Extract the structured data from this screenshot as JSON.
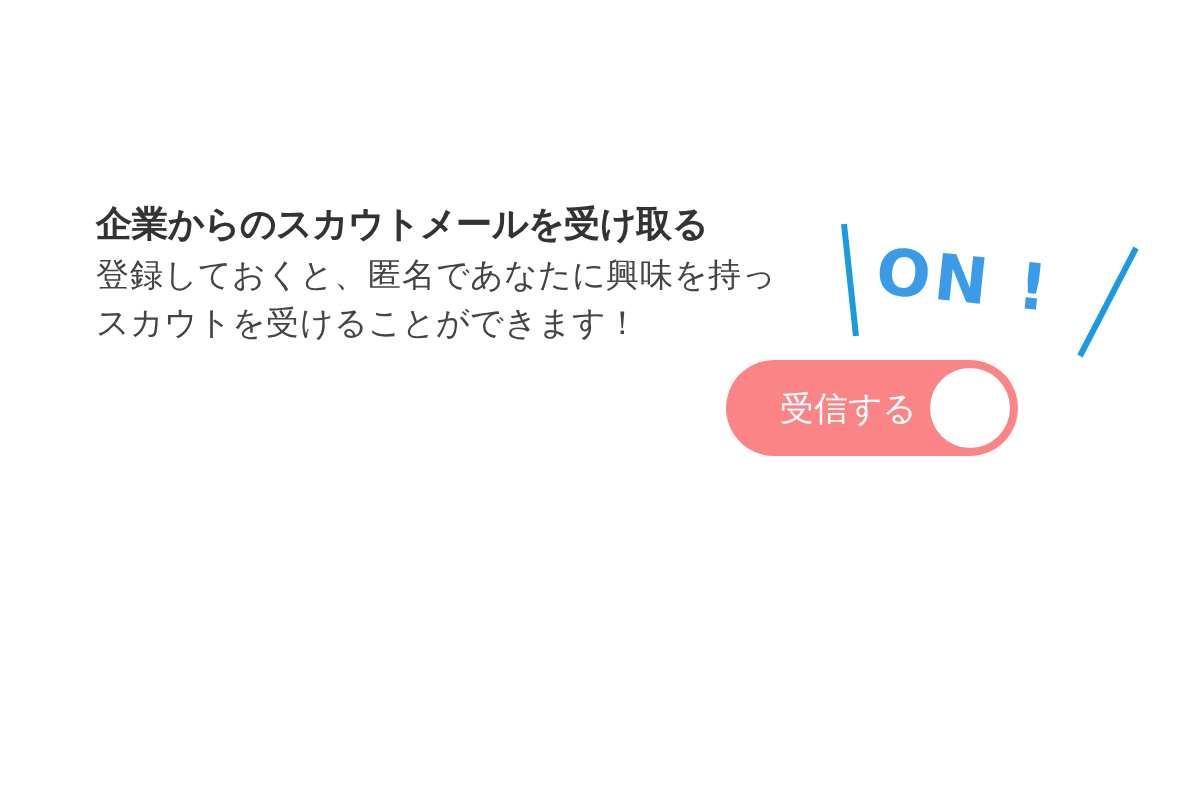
{
  "heading": "企業からのスカウトメールを受け取る",
  "description": "登録しておくと、匿名であなたに興味を持っスカウトを受けることができます！",
  "toggle": {
    "label": "受信する",
    "on": true
  },
  "callout": "ON !"
}
